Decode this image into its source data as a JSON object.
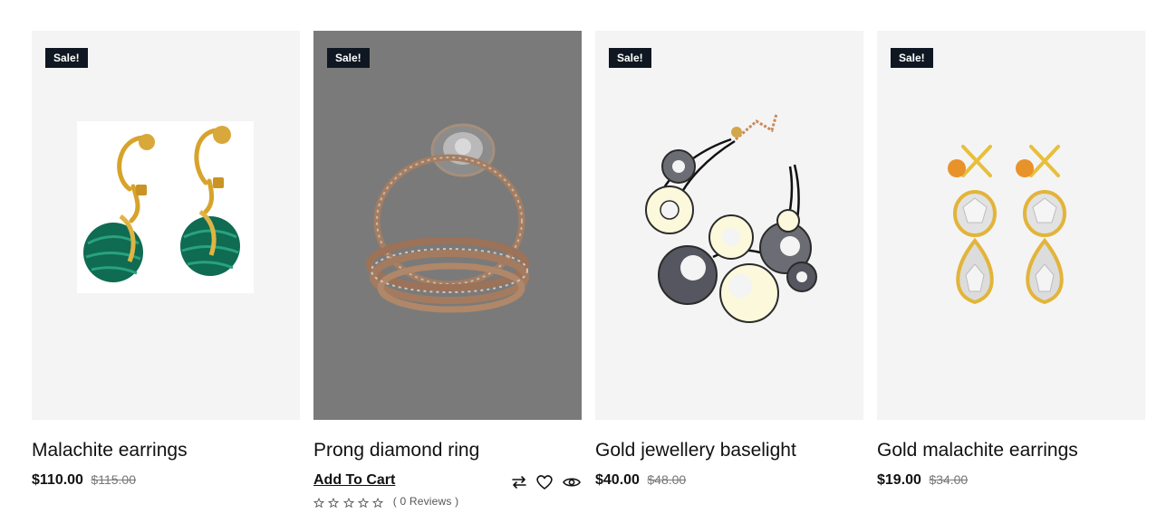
{
  "products": [
    {
      "badge": "Sale!",
      "title": "Malachite earrings",
      "price": "$110.00",
      "old_price": "$115.00",
      "image": "malachite-earrings-image"
    },
    {
      "badge": "Sale!",
      "title": "Prong diamond ring",
      "add_to_cart": "Add To Cart",
      "reviews": "( 0 Reviews )",
      "rating": 0,
      "rating_max": 5,
      "icons": [
        "compare-icon",
        "heart-icon",
        "eye-icon"
      ],
      "image": "prong-diamond-ring-image"
    },
    {
      "badge": "Sale!",
      "title": "Gold jewellery baselight",
      "price": "$40.00",
      "old_price": "$48.00",
      "image": "bracelet-image"
    },
    {
      "badge": "Sale!",
      "title": "Gold malachite earrings",
      "price": "$19.00",
      "old_price": "$34.00",
      "image": "crystal-earrings-image"
    }
  ],
  "colors": {
    "badge_bg": "#0f1822",
    "card_bg": "#f4f4f4",
    "hover_overlay": "#7a7a7a",
    "text": "#111418",
    "muted": "#777777"
  }
}
